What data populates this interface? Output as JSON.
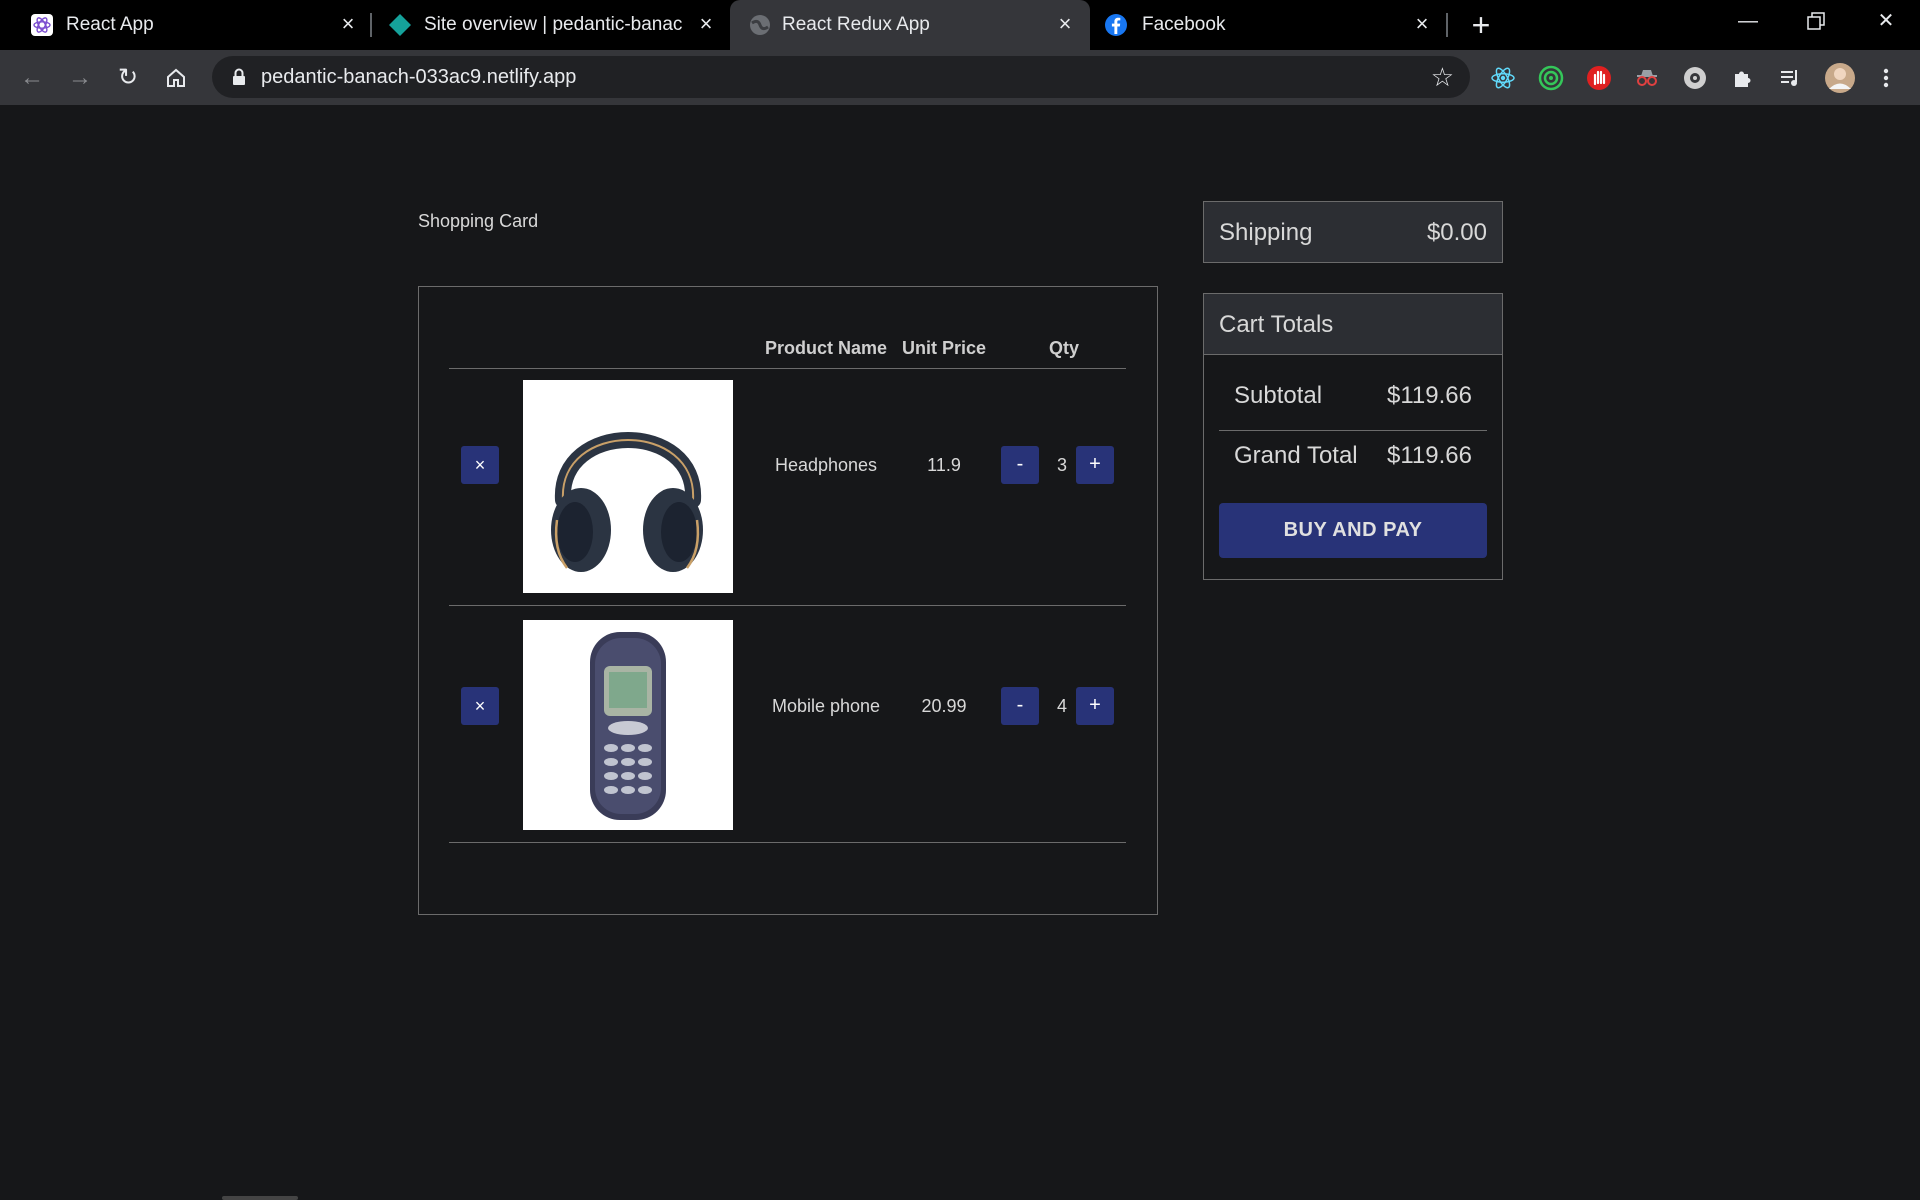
{
  "browser": {
    "tabs": [
      {
        "title": "React App",
        "icon": "react-app-icon",
        "active": false
      },
      {
        "title": "Site overview | pedantic-banach-",
        "icon": "netlify-icon",
        "active": false
      },
      {
        "title": "React Redux App",
        "icon": "globe-icon",
        "active": true
      },
      {
        "title": "Facebook",
        "icon": "facebook-icon",
        "active": false
      }
    ],
    "url": "pedantic-banach-033ac9.netlify.app"
  },
  "page": {
    "heading": "Shopping Card",
    "columns": {
      "product_name": "Product Name",
      "unit_price": "Unit Price",
      "qty": "Qty"
    },
    "items": [
      {
        "remove_label": "×",
        "image": "headphones-image",
        "name": "Headphones",
        "price": "11.9",
        "decrement": "-",
        "qty": "3",
        "increment": "+"
      },
      {
        "remove_label": "×",
        "image": "mobile-phone-image",
        "name": "Mobile phone",
        "price": "20.99",
        "decrement": "-",
        "qty": "4",
        "increment": "+"
      }
    ],
    "shipping": {
      "label": "Shipping",
      "value": "$0.00"
    },
    "totals": {
      "title": "Cart Totals",
      "subtotal_label": "Subtotal",
      "subtotal_value": "$119.66",
      "grand_total_label": "Grand Total",
      "grand_total_value": "$119.66",
      "buy_label": "BUY AND PAY"
    }
  },
  "colors": {
    "accent": "#283378",
    "background": "#161719",
    "panel": "#2c2e33"
  }
}
